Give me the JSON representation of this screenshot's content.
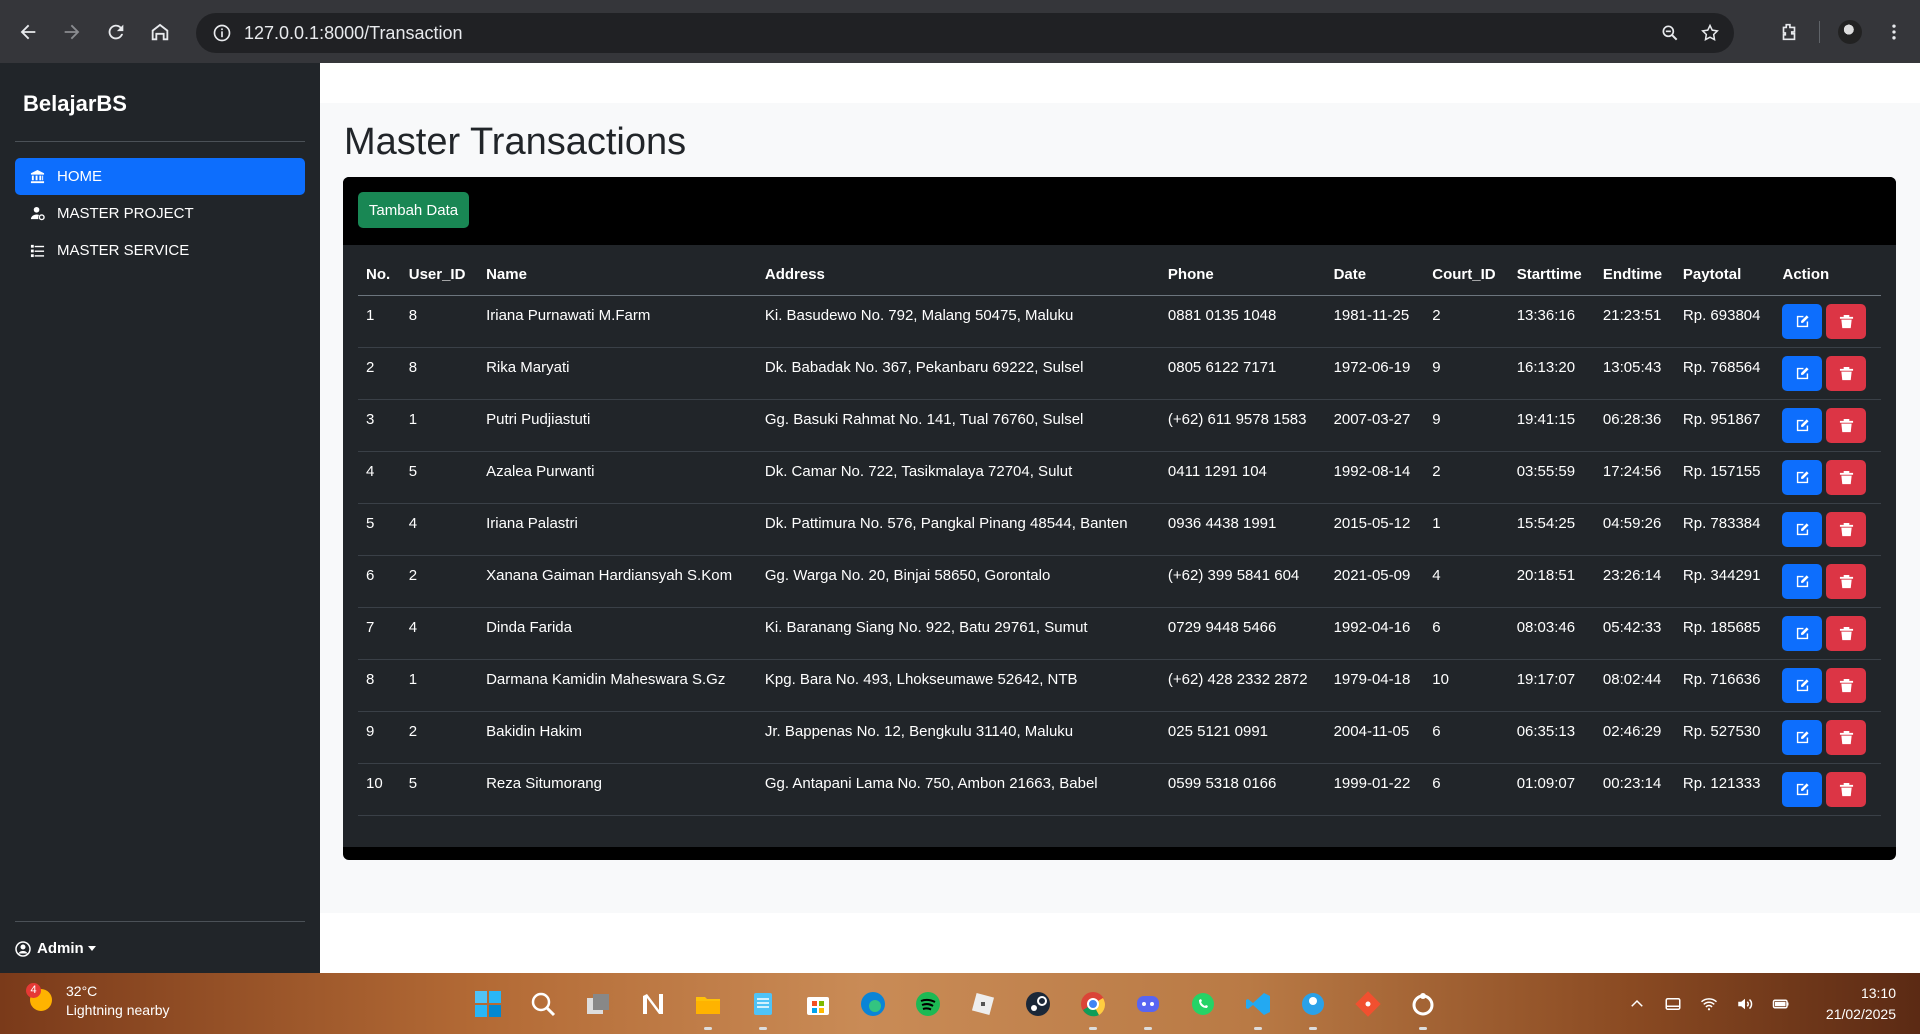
{
  "browser": {
    "url": "127.0.0.1:8000/Transaction"
  },
  "sidebar": {
    "brand": "BelajarBS",
    "items": [
      {
        "label": "HOME",
        "icon": "bank-icon",
        "active": true
      },
      {
        "label": "MASTER PROJECT",
        "icon": "person-gear-icon",
        "active": false
      },
      {
        "label": "MASTER SERVICE",
        "icon": "list-icon",
        "active": false
      }
    ],
    "user": "Admin"
  },
  "main": {
    "title": "Master Transactions",
    "add_button": "Tambah Data",
    "columns": [
      "No.",
      "User_ID",
      "Name",
      "Address",
      "Phone",
      "Date",
      "Court_ID",
      "Starttime",
      "Endtime",
      "Paytotal",
      "Action"
    ],
    "rows": [
      [
        "1",
        "8",
        "Iriana Purnawati M.Farm",
        "Ki. Basudewo No. 792, Malang 50475, Maluku",
        "0881 0135 1048",
        "1981-11-25",
        "2",
        "13:36:16",
        "21:23:51",
        "Rp. 693804"
      ],
      [
        "2",
        "8",
        "Rika Maryati",
        "Dk. Babadak No. 367, Pekanbaru 69222, Sulsel",
        "0805 6122 7171",
        "1972-06-19",
        "9",
        "16:13:20",
        "13:05:43",
        "Rp. 768564"
      ],
      [
        "3",
        "1",
        "Putri Pudjiastuti",
        "Gg. Basuki Rahmat No. 141, Tual 76760, Sulsel",
        "(+62) 611 9578 1583",
        "2007-03-27",
        "9",
        "19:41:15",
        "06:28:36",
        "Rp. 951867"
      ],
      [
        "4",
        "5",
        "Azalea Purwanti",
        "Dk. Camar No. 722, Tasikmalaya 72704, Sulut",
        "0411 1291 104",
        "1992-08-14",
        "2",
        "03:55:59",
        "17:24:56",
        "Rp. 157155"
      ],
      [
        "5",
        "4",
        "Iriana Palastri",
        "Dk. Pattimura No. 576, Pangkal Pinang 48544, Banten",
        "0936 4438 1991",
        "2015-05-12",
        "1",
        "15:54:25",
        "04:59:26",
        "Rp. 783384"
      ],
      [
        "6",
        "2",
        "Xanana Gaiman Hardiansyah S.Kom",
        "Gg. Warga No. 20, Binjai 58650, Gorontalo",
        "(+62) 399 5841 604",
        "2021-05-09",
        "4",
        "20:18:51",
        "23:26:14",
        "Rp. 344291"
      ],
      [
        "7",
        "4",
        "Dinda Farida",
        "Ki. Baranang Siang No. 922, Batu 29761, Sumut",
        "0729 9448 5466",
        "1992-04-16",
        "6",
        "08:03:46",
        "05:42:33",
        "Rp. 185685"
      ],
      [
        "8",
        "1",
        "Darmana Kamidin Maheswara S.Gz",
        "Kpg. Bara No. 493, Lhokseumawe 52642, NTB",
        "(+62) 428 2332 2872",
        "1979-04-18",
        "10",
        "19:17:07",
        "08:02:44",
        "Rp. 716636"
      ],
      [
        "9",
        "2",
        "Bakidin Hakim",
        "Jr. Bappenas No. 12, Bengkulu 31140, Maluku",
        "025 5121 0991",
        "2004-11-05",
        "6",
        "06:35:13",
        "02:46:29",
        "Rp. 527530"
      ],
      [
        "10",
        "5",
        "Reza Situmorang",
        "Gg. Antapani Lama No. 750, Ambon 21663, Babel",
        "0599 5318 0166",
        "1999-01-22",
        "6",
        "01:09:07",
        "00:23:14",
        "Rp. 121333"
      ]
    ]
  },
  "taskbar": {
    "weather_badge": "4",
    "temperature": "32°C",
    "weather_text": "Lightning nearby",
    "time": "13:10",
    "date": "21/02/2025",
    "apps": [
      "windows-start-icon",
      "search-icon",
      "task-view-icon",
      "notion-icon",
      "file-explorer-icon",
      "notepad-icon",
      "store-icon",
      "edge-icon",
      "spotify-icon",
      "roblox-icon",
      "steam-icon",
      "chrome-icon",
      "discord-icon",
      "whatsapp-icon",
      "vscode-icon",
      "app-icon",
      "git-icon",
      "obs-icon"
    ]
  },
  "colors": {
    "sidebar_bg": "#212529",
    "primary": "#0d6efd",
    "success": "#198754",
    "danger": "#dc3545"
  }
}
